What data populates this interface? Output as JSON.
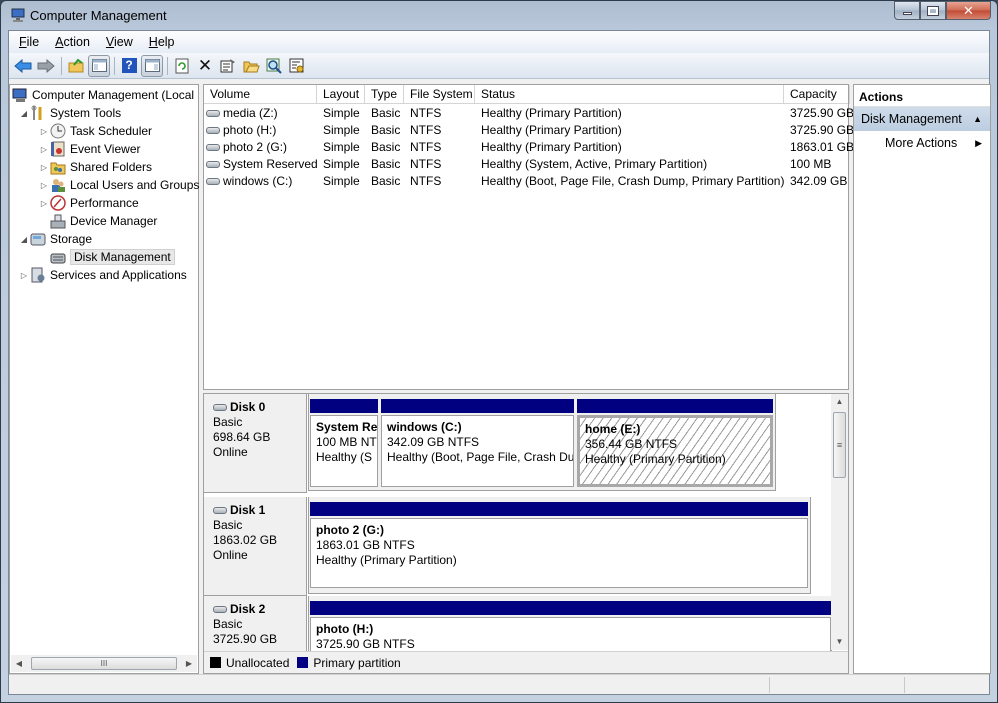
{
  "window": {
    "title": "Computer Management",
    "controls": {
      "minimize": "minimize",
      "maximize": "maximize",
      "close": "close"
    }
  },
  "menu": [
    {
      "label": "File",
      "accel": "F",
      "rest": "ile"
    },
    {
      "label": "Action",
      "accel": "A",
      "rest": "ction"
    },
    {
      "label": "View",
      "accel": "V",
      "rest": "iew"
    },
    {
      "label": "Help",
      "accel": "H",
      "rest": "elp"
    }
  ],
  "toolbar": {
    "buttons": [
      {
        "name": "back",
        "icon": "back-arrow-icon"
      },
      {
        "name": "forward",
        "icon": "forward-arrow-icon"
      },
      {
        "name": "up-folder",
        "icon": "up-folder-icon"
      },
      {
        "name": "show-hide-console-tree",
        "icon": "console-tree-icon"
      },
      {
        "name": "help",
        "icon": "help-icon"
      },
      {
        "name": "show-hide-action-pane",
        "icon": "action-pane-icon"
      },
      {
        "name": "refresh",
        "icon": "refresh-icon"
      },
      {
        "name": "delete",
        "icon": "delete-icon"
      },
      {
        "name": "properties",
        "icon": "properties-icon"
      },
      {
        "name": "open",
        "icon": "open-folder-icon"
      },
      {
        "name": "search",
        "icon": "magnifier-icon"
      },
      {
        "name": "settings",
        "icon": "settings-icon"
      }
    ]
  },
  "tree": {
    "items": [
      {
        "label": "Computer Management (Local",
        "level": 0,
        "arrow": "",
        "icon": "computer-icon"
      },
      {
        "label": "System Tools",
        "level": 1,
        "arrow": "expanded",
        "icon": "tools-icon"
      },
      {
        "label": "Task Scheduler",
        "level": 2,
        "arrow": "collapsed",
        "icon": "clock-icon"
      },
      {
        "label": "Event Viewer",
        "level": 2,
        "arrow": "collapsed",
        "icon": "event-viewer-icon"
      },
      {
        "label": "Shared Folders",
        "level": 2,
        "arrow": "collapsed",
        "icon": "shared-folder-icon"
      },
      {
        "label": "Local Users and Groups",
        "level": 2,
        "arrow": "collapsed",
        "icon": "users-icon"
      },
      {
        "label": "Performance",
        "level": 2,
        "arrow": "collapsed",
        "icon": "performance-icon"
      },
      {
        "label": "Device Manager",
        "level": 2,
        "arrow": "",
        "icon": "device-manager-icon"
      },
      {
        "label": "Storage",
        "level": 1,
        "arrow": "expanded",
        "icon": "storage-icon"
      },
      {
        "label": "Disk Management",
        "level": 2,
        "arrow": "",
        "icon": "disk-management-icon",
        "selected": true
      },
      {
        "label": "Services and Applications",
        "level": 1,
        "arrow": "collapsed",
        "icon": "services-icon"
      }
    ],
    "hscroll_thumb": "III"
  },
  "volumes": {
    "columns": [
      "Volume",
      "Layout",
      "Type",
      "File System",
      "Status",
      "Capacity"
    ],
    "rows": [
      {
        "volume": "media (Z:)",
        "layout": "Simple",
        "type": "Basic",
        "fs": "NTFS",
        "status": "Healthy (Primary Partition)",
        "capacity": "3725.90 GB"
      },
      {
        "volume": "photo (H:)",
        "layout": "Simple",
        "type": "Basic",
        "fs": "NTFS",
        "status": "Healthy (Primary Partition)",
        "capacity": "3725.90 GB"
      },
      {
        "volume": "photo 2 (G:)",
        "layout": "Simple",
        "type": "Basic",
        "fs": "NTFS",
        "status": "Healthy (Primary Partition)",
        "capacity": "1863.01 GB"
      },
      {
        "volume": "System Reserved",
        "layout": "Simple",
        "type": "Basic",
        "fs": "NTFS",
        "status": "Healthy (System, Active, Primary Partition)",
        "capacity": "100 MB"
      },
      {
        "volume": "windows (C:)",
        "layout": "Simple",
        "type": "Basic",
        "fs": "NTFS",
        "status": "Healthy (Boot, Page File, Crash Dump, Primary Partition)",
        "capacity": "342.09 GB"
      }
    ]
  },
  "disks": [
    {
      "name": "Disk 0",
      "type": "Basic",
      "size": "698.64 GB",
      "state": "Online",
      "partitions": [
        {
          "title": "System Re",
          "size": "100 MB NT",
          "status": "Healthy (S"
        },
        {
          "title": "windows  (C:)",
          "size": "342.09 GB NTFS",
          "status": "Healthy (Boot, Page File, Crash Du"
        },
        {
          "title": "home  (E:)",
          "size": "356.44 GB NTFS",
          "status": "Healthy (Primary Partition)",
          "selected": true
        }
      ]
    },
    {
      "name": "Disk 1",
      "type": "Basic",
      "size": "1863.02 GB",
      "state": "Online",
      "partitions": [
        {
          "title": "photo 2  (G:)",
          "size": "1863.01 GB NTFS",
          "status": "Healthy (Primary Partition)"
        }
      ]
    },
    {
      "name": "Disk 2",
      "type": "Basic",
      "size": "3725.90 GB",
      "state": "",
      "partitions": [
        {
          "title": "photo  (H:)",
          "size": "3725.90 GB NTFS",
          "status": ""
        }
      ]
    }
  ],
  "legend": [
    {
      "label": "Unallocated",
      "color": "#000000"
    },
    {
      "label": "Primary partition",
      "color": "#000080"
    }
  ],
  "actions": {
    "header": "Actions",
    "section": "Disk Management",
    "items": [
      "More Actions"
    ]
  },
  "colors": {
    "primary_partition": "#000080",
    "unallocated": "#000000",
    "actions_section_bg": "#c6d5e6"
  }
}
